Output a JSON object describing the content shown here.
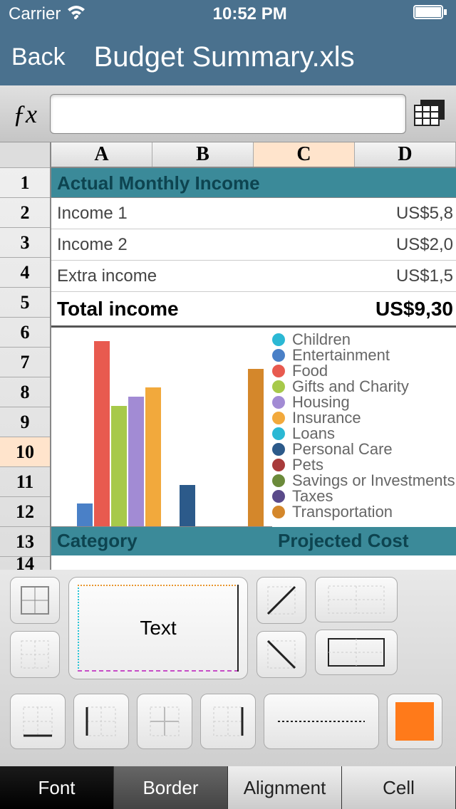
{
  "status": {
    "carrier": "Carrier",
    "time": "10:52 PM"
  },
  "nav": {
    "back": "Back",
    "title": "Budget Summary.xls"
  },
  "fx": "ƒx",
  "cols": [
    "A",
    "B",
    "C",
    "D"
  ],
  "rows": [
    "1",
    "2",
    "3",
    "4",
    "5",
    "6",
    "7",
    "8",
    "9",
    "10",
    "11",
    "12",
    "13",
    "14"
  ],
  "section1": "Actual Monthly Income",
  "income": [
    {
      "label": "Income 1",
      "value": "US$5,8"
    },
    {
      "label": "Income 2",
      "value": "US$2,0"
    },
    {
      "label": "Extra income",
      "value": "US$1,5"
    }
  ],
  "total": {
    "label": "Total income",
    "value": "US$9,30"
  },
  "legend": [
    {
      "label": "Children",
      "color": "#2bb8d4"
    },
    {
      "label": "Entertainment",
      "color": "#4a80c7"
    },
    {
      "label": "Food",
      "color": "#e85a4f"
    },
    {
      "label": "Gifts and Charity",
      "color": "#a7c94a"
    },
    {
      "label": "Housing",
      "color": "#a28bd4"
    },
    {
      "label": "Insurance",
      "color": "#f2a93c"
    },
    {
      "label": "Loans",
      "color": "#2bb8d4"
    },
    {
      "label": "Personal Care",
      "color": "#2c5a8a"
    },
    {
      "label": "Pets",
      "color": "#a83b3b"
    },
    {
      "label": "Savings or Investments",
      "color": "#6b8a3a"
    },
    {
      "label": "Taxes",
      "color": "#5a4a8a"
    },
    {
      "label": "Transportation",
      "color": "#d4872b"
    }
  ],
  "catrow": {
    "c1": "Category",
    "c2": "Projected Cost"
  },
  "preview_text": "Text",
  "tabs": [
    "Font",
    "Border",
    "Alignment",
    "Cell"
  ],
  "active_tab": 1,
  "chart_data": {
    "type": "bar",
    "title": "",
    "categories": [
      "Children",
      "Entertainment",
      "Food",
      "Gifts and Charity",
      "Housing",
      "Insurance",
      "Loans",
      "Personal Care",
      "Pets",
      "Savings or Investments",
      "Taxes",
      "Transportation"
    ],
    "values": [
      0,
      25,
      200,
      130,
      140,
      150,
      0,
      45,
      0,
      0,
      0,
      170
    ],
    "colors": [
      "#2bb8d4",
      "#4a80c7",
      "#e85a4f",
      "#a7c94a",
      "#a28bd4",
      "#f2a93c",
      "#2bb8d4",
      "#2c5a8a",
      "#a83b3b",
      "#6b8a3a",
      "#5a4a8a",
      "#d4872b"
    ],
    "ylim": [
      0,
      200
    ]
  }
}
